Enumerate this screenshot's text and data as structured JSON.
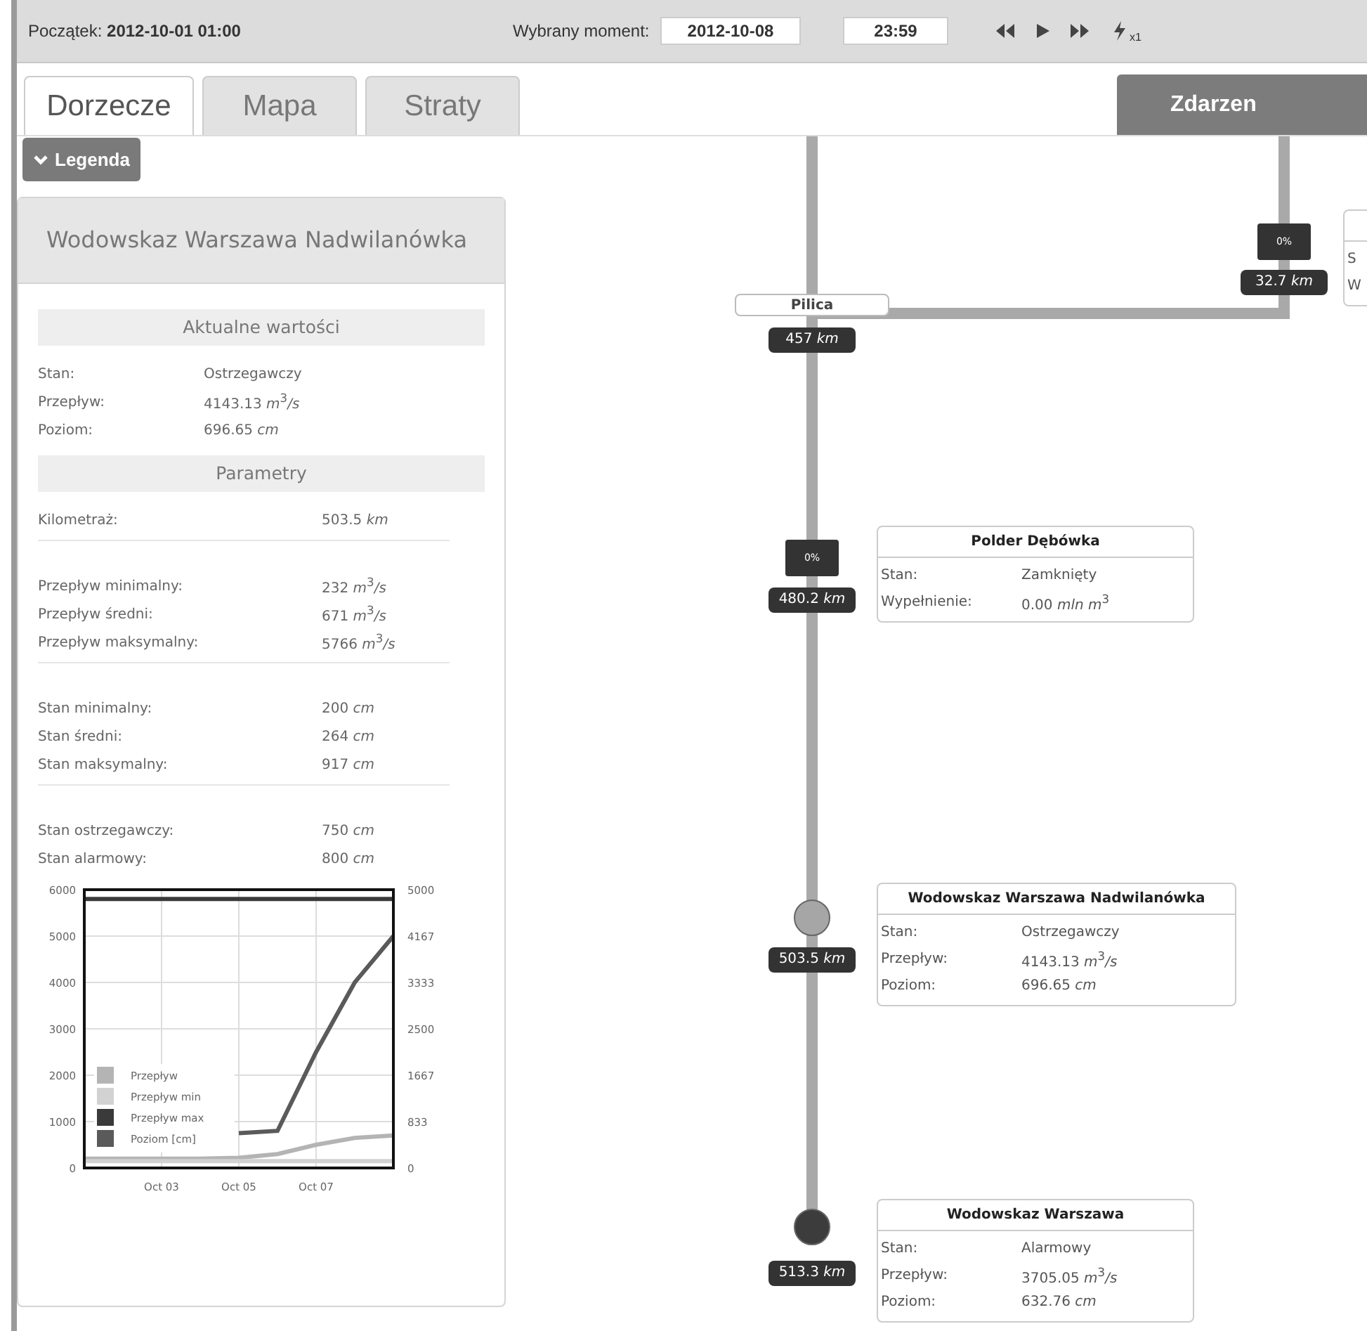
{
  "toolbar": {
    "start": "Początek: **2012-10-01 01:00**",
    "moment_label": "Wybrany moment:",
    "date": "2012-10-08",
    "time": "23:59",
    "speed": "x1"
  },
  "tabs": [
    {
      "label": "Dorzecze",
      "selected": true
    },
    {
      "label": "Mapa",
      "selected": false
    },
    {
      "label": "Straty",
      "selected": false
    }
  ],
  "events_button": "Zdarzen",
  "legend_button": "Legenda",
  "panel": {
    "title": "Wodowskaz Warszawa Nadwilanówka",
    "sections": [
      {
        "heading": "Aktualne wartości",
        "groups": [
          [
            {
              "label": "Stan:",
              "value": "Ostrzegawczy"
            },
            {
              "label": "Przepływ:",
              "value": "4143.13 *m*$^{3}$*/s*"
            },
            {
              "label": "Poziom:",
              "value": "696.65 *cm*"
            }
          ]
        ]
      },
      {
        "heading": "Parametry",
        "groups": [
          [
            {
              "label": "Kilometraż:",
              "value": "503.5 *km*"
            }
          ],
          [
            {
              "label": "Przepływ minimalny:",
              "value": "232 *m*$^{3}$*/s*"
            },
            {
              "label": "Przepływ średni:",
              "value": "671 *m*$^{3}$*/s*"
            },
            {
              "label": "Przepływ maksymalny:",
              "value": "5766 *m*$^{3}$*/s*"
            }
          ],
          [
            {
              "label": "Stan minimalny:",
              "value": "200 *cm*"
            },
            {
              "label": "Stan średni:",
              "value": "264 *cm*"
            },
            {
              "label": "Stan maksymalny:",
              "value": "917 *cm*"
            }
          ],
          [
            {
              "label": "Stan ostrzegawczy:",
              "value": "750 *cm*"
            },
            {
              "label": "Stan alarmowy:",
              "value": "800 *cm*"
            }
          ]
        ]
      }
    ],
    "chart_data": {
      "type": "line",
      "categories": [
        null,
        null,
        "Oct 03",
        null,
        "Oct 05",
        null,
        "Oct 07",
        null,
        null
      ],
      "ylim": [
        0,
        6000
      ],
      "yticks": [
        0,
        1000,
        2000,
        3000,
        4000,
        5000,
        6000
      ],
      "y2lim": [
        0,
        5000
      ],
      "y2ticks": [
        0,
        833,
        1667,
        2500,
        3333,
        4167,
        5000
      ],
      "legend": "lower left",
      "series": [
        {
          "name": "Przepływ",
          "color": "#b4b4b4",
          "values": [
            200,
            200,
            200,
            200,
            220,
            300,
            500,
            650,
            700
          ]
        },
        {
          "name": "Przepływ min",
          "color": "#d2d2d2",
          "values": [
            150,
            150,
            150,
            150,
            150,
            150,
            150,
            150,
            150
          ]
        },
        {
          "name": "Przepływ max",
          "color": "#3a3a3a",
          "values": [
            5800,
            5800,
            5800,
            5800,
            5800,
            5800,
            5800,
            5800,
            5800
          ]
        },
        {
          "name": "Poziom [cm]",
          "color": "#5a5a5a",
          "values": [
            null,
            null,
            null,
            null,
            750,
            800,
            2500,
            4000,
            5000
          ]
        }
      ]
    }
  },
  "nodes": [
    {
      "kind": "reservoir",
      "fill": "0%",
      "km": "32.7 *km*",
      "card": {
        "rows": [
          {
            "label": "S"
          },
          {
            "label": "W"
          }
        ]
      }
    },
    {
      "kind": "junction",
      "name": "Pilica",
      "km": "457 *km*"
    },
    {
      "kind": "reservoir",
      "fill": "0%",
      "km": "480.2 *km*",
      "card": {
        "title": "Polder Dębówka",
        "rows": [
          {
            "label": "Stan:",
            "value": "Zamknięty"
          },
          {
            "label": "Wypełnienie:",
            "value": "0.00 *mln m*$^{3}$"
          }
        ]
      }
    },
    {
      "kind": "gauge",
      "color": "#a6a6a6",
      "km": "503.5 *km*",
      "card": {
        "title": "Wodowskaz Warszawa Nadwilanówka",
        "rows": [
          {
            "label": "Stan:",
            "value": "Ostrzegawczy"
          },
          {
            "label": "Przepływ:",
            "value": "4143.13 *m*$^{3}$*/s*"
          },
          {
            "label": "Poziom:",
            "value": "696.65 *cm*"
          }
        ]
      }
    },
    {
      "kind": "gauge",
      "color": "#3c3c3c",
      "km": "513.3 *km*",
      "card": {
        "title": "Wodowskaz Warszawa",
        "rows": [
          {
            "label": "Stan:",
            "value": "Alarmowy"
          },
          {
            "label": "Przepływ:",
            "value": "3705.05 *m*$^{3}$*/s*"
          },
          {
            "label": "Poziom:",
            "value": "632.76 *cm*"
          }
        ]
      }
    }
  ]
}
